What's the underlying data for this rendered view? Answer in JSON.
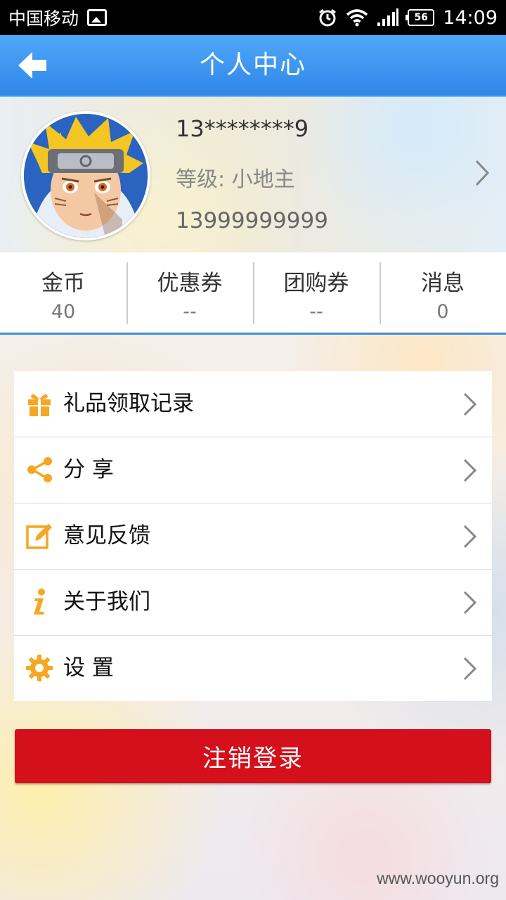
{
  "status_bar": {
    "carrier": "中国移动",
    "battery": "56",
    "time": "14:09",
    "icons": [
      "image-icon",
      "alarm-icon",
      "wifi-icon",
      "signal-icon",
      "battery-icon"
    ]
  },
  "header": {
    "title": "个人中心",
    "back_icon": "arrow-left-icon",
    "color": "#3a8fef"
  },
  "profile": {
    "name": "13********9",
    "level": "等级: 小地主",
    "phone": "13999999999"
  },
  "stats": [
    {
      "label": "金币",
      "value": "40"
    },
    {
      "label": "优惠券",
      "value": "--"
    },
    {
      "label": "团购券",
      "value": "--"
    },
    {
      "label": "消息",
      "value": "0"
    }
  ],
  "menu": [
    {
      "label": "礼品领取记录",
      "icon": "gift-icon"
    },
    {
      "label": "分 享",
      "icon": "share-icon"
    },
    {
      "label": "意见反馈",
      "icon": "edit-icon"
    },
    {
      "label": "关于我们",
      "icon": "info-icon"
    },
    {
      "label": "设 置",
      "icon": "gear-icon"
    }
  ],
  "logout_label": "注销登录",
  "watermark": "www.wooyun.org",
  "colors": {
    "accent": "#f5a623",
    "logout": "#d4101c",
    "divider": "#3f8ddb"
  }
}
